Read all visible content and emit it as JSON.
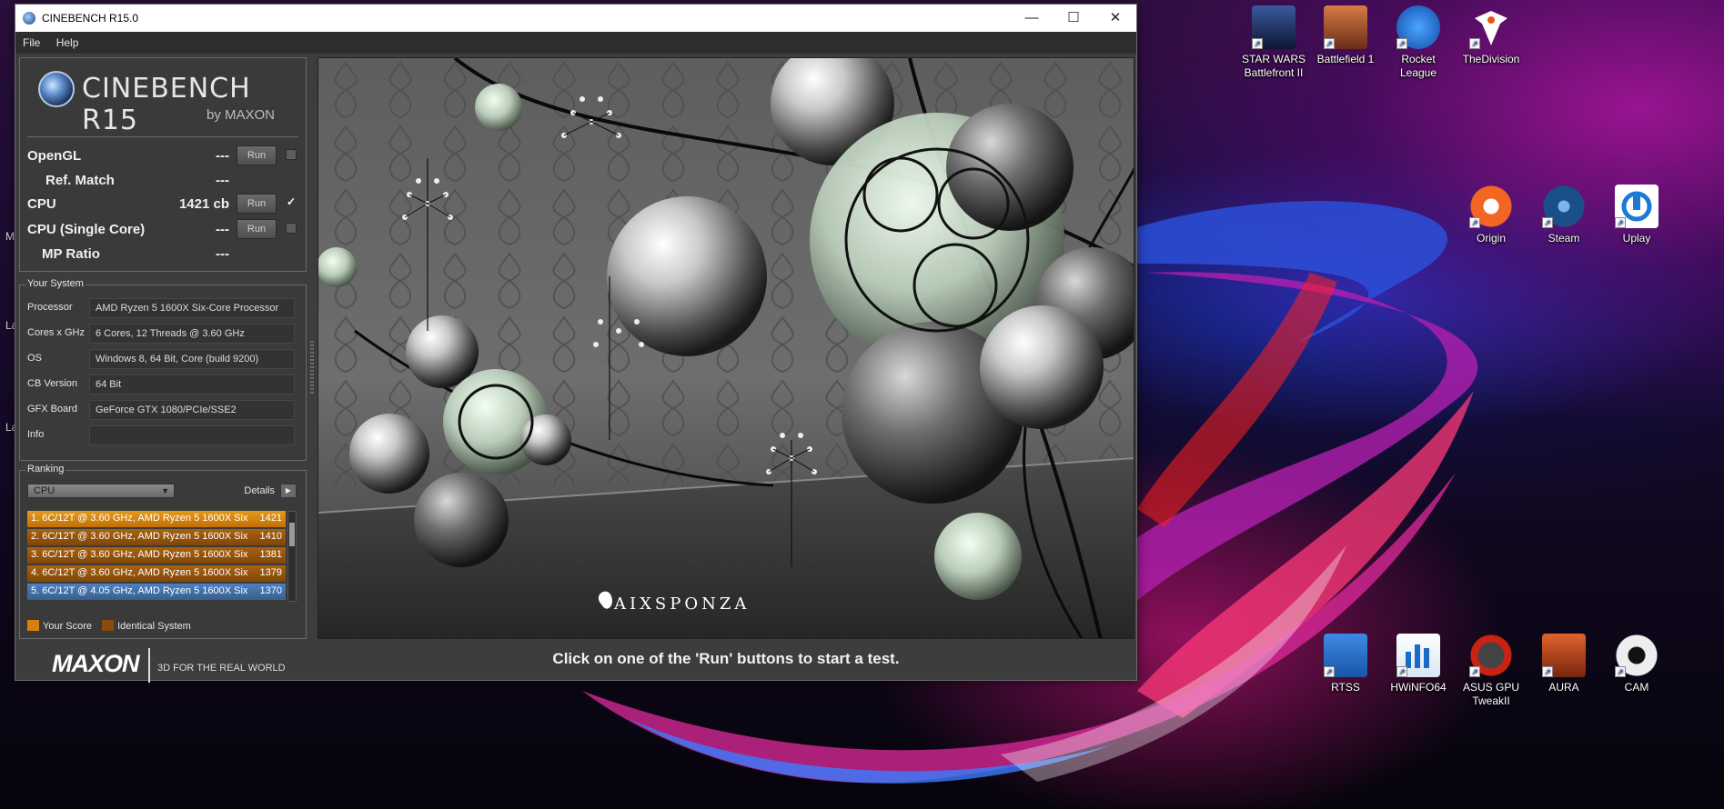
{
  "window": {
    "title": "CINEBENCH R15.0",
    "minimize": "—",
    "maximize": "☐",
    "close": "✕"
  },
  "menu": {
    "file": "File",
    "help": "Help"
  },
  "logo": {
    "name": "CINEBENCH R15",
    "byline": "by MAXON"
  },
  "tests": [
    {
      "label": "OpenGL",
      "value": "---",
      "run": "Run",
      "checked": false
    },
    {
      "label": "Ref. Match",
      "value": "---"
    },
    {
      "label": "CPU",
      "value": "1421 cb",
      "run": "Run",
      "checked": true
    },
    {
      "label": "CPU (Single Core)",
      "value": "---",
      "run": "Run",
      "checked": false
    },
    {
      "label": "MP Ratio",
      "value": "---"
    }
  ],
  "your_system": {
    "title": "Your System",
    "rows": [
      {
        "key": "Processor",
        "value": "AMD Ryzen 5 1600X Six-Core Processor"
      },
      {
        "key": "Cores x GHz",
        "value": "6 Cores, 12 Threads @ 3.60 GHz"
      },
      {
        "key": "OS",
        "value": "Windows 8, 64 Bit, Core (build 9200)"
      },
      {
        "key": "CB Version",
        "value": "64 Bit"
      },
      {
        "key": "GFX Board",
        "value": "GeForce GTX 1080/PCIe/SSE2"
      },
      {
        "key": "Info",
        "value": ""
      }
    ]
  },
  "ranking": {
    "title": "Ranking",
    "select": "CPU",
    "details": "Details",
    "items": [
      {
        "label": "1. 6C/12T @ 3.60 GHz, AMD Ryzen 5 1600X Six",
        "score": "1421",
        "style": "orange"
      },
      {
        "label": "2. 6C/12T @ 3.60 GHz, AMD Ryzen 5 1600X Six",
        "score": "1410",
        "style": "brown"
      },
      {
        "label": "3. 6C/12T @ 3.60 GHz, AMD Ryzen 5 1600X Six",
        "score": "1381",
        "style": "brown"
      },
      {
        "label": "4. 6C/12T @ 3.60 GHz, AMD Ryzen 5 1600X Six",
        "score": "1379",
        "style": "brown"
      },
      {
        "label": "5. 6C/12T @ 4.05 GHz, AMD Ryzen 5 1600X Six",
        "score": "1370",
        "style": "blue"
      }
    ],
    "legend_your_score": "Your Score",
    "legend_identical": "Identical System",
    "colors": {
      "your_score": "#d97f0f",
      "identical": "#8a4c0a"
    }
  },
  "footer": {
    "maxon": "MAXON",
    "tagline": "3D FOR THE REAL WORLD"
  },
  "render": {
    "watermark": "AIXSPONZA"
  },
  "status": "Click on one of the 'Run' buttons to start a test.",
  "desktop": {
    "edge_letters": [
      "M",
      "La",
      "La"
    ],
    "icons": [
      {
        "label": "STAR WARS Battlefront II",
        "icon": "star-wars-battlefront-icon",
        "color": "#1d2f5a"
      },
      {
        "label": "Battlefield 1",
        "icon": "battlefield-icon",
        "color": "#b7542c"
      },
      {
        "label": "Rocket League",
        "icon": "rocket-league-icon",
        "color": "#1a6fd9"
      },
      {
        "label": "TheDivision",
        "icon": "the-division-icon",
        "color": "#ffffff"
      },
      {
        "label": "Origin",
        "icon": "origin-icon",
        "color": "#f26522"
      },
      {
        "label": "Steam",
        "icon": "steam-icon",
        "color": "#1b4f8a"
      },
      {
        "label": "Uplay",
        "icon": "uplay-icon",
        "color": "#ffffff"
      },
      {
        "label": "RTSS",
        "icon": "rtss-icon",
        "color": "#2b78d6"
      },
      {
        "label": "HWiNFO64",
        "icon": "hwinfo-icon",
        "color": "#2a74c9"
      },
      {
        "label": "ASUS GPU TweakII",
        "icon": "asus-gpu-tweak-icon",
        "color": "#222222"
      },
      {
        "label": "AURA",
        "icon": "aura-icon",
        "color": "#c24a1c"
      },
      {
        "label": "CAM",
        "icon": "cam-icon",
        "color": "#eeeeee"
      }
    ]
  }
}
